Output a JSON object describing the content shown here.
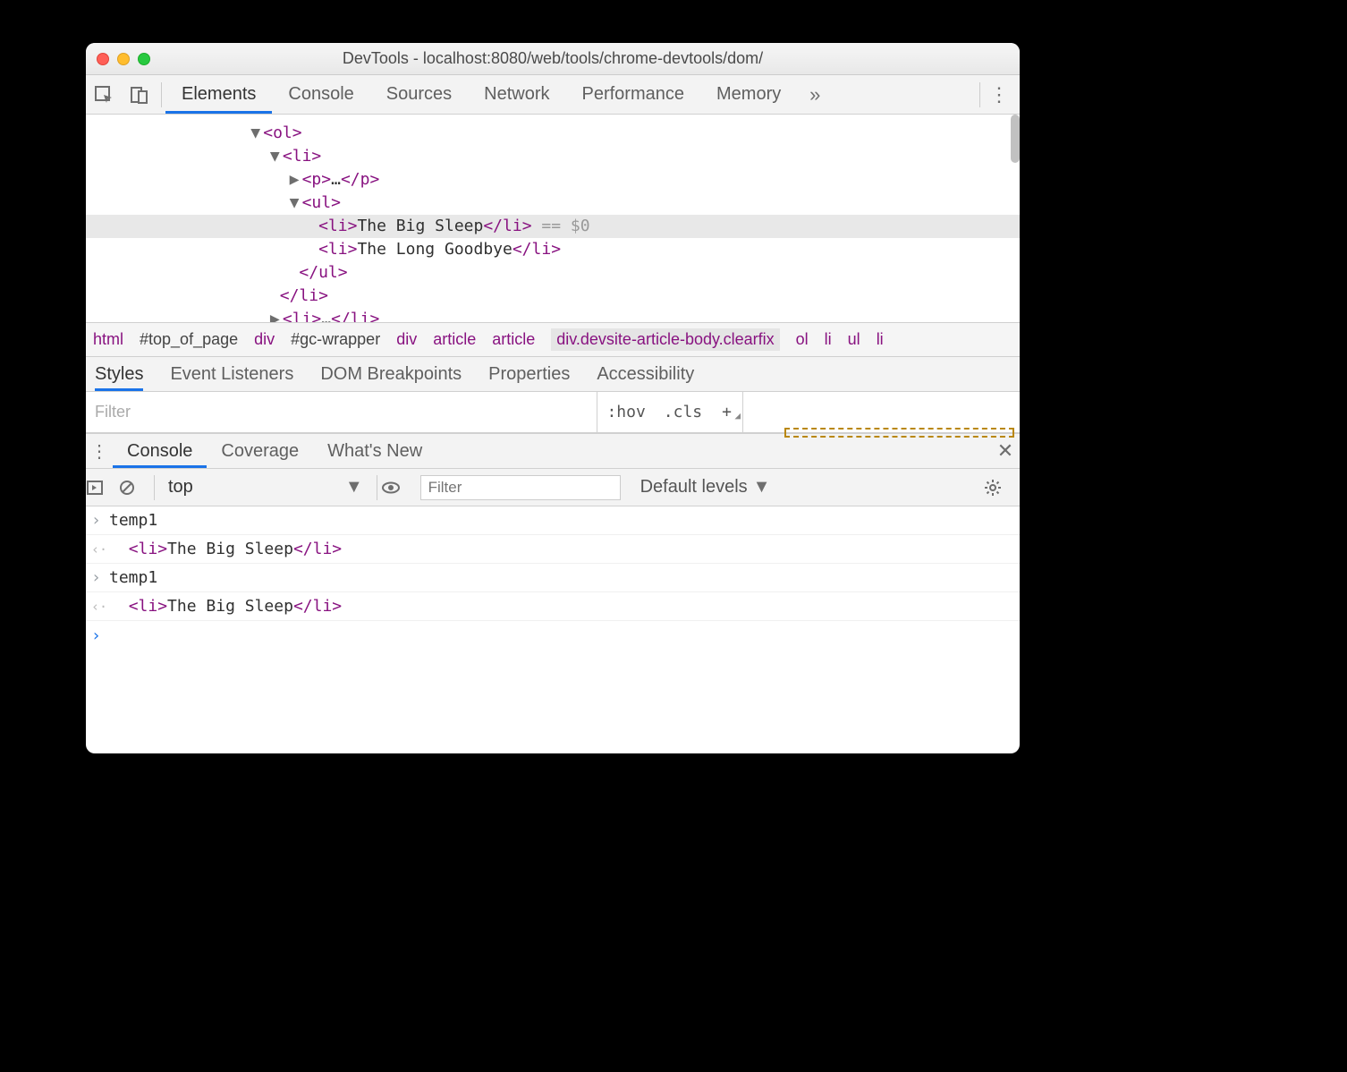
{
  "window": {
    "title": "DevTools - localhost:8080/web/tools/chrome-devtools/dom/"
  },
  "main_tabs": {
    "items": [
      "Elements",
      "Console",
      "Sources",
      "Network",
      "Performance",
      "Memory"
    ],
    "active_index": 0,
    "overflow_glyph": "»"
  },
  "dom": {
    "ol_open": "<ol>",
    "li_open": "<li>",
    "p_collapsed": "<p>…</p>",
    "ul_open": "<ul>",
    "li_text_1": "The Big Sleep",
    "li_text_2": "The Long Goodbye",
    "ul_close": "</ul>",
    "li_close": "</li>",
    "li_collapsed": "<li>…</li>",
    "refvar": "== $0"
  },
  "breadcrumb": {
    "items": [
      "html",
      "#top_of_page",
      "div",
      "#gc-wrapper",
      "div",
      "article",
      "article",
      "div.devsite-article-body.clearfix",
      "ol",
      "li",
      "ul",
      "li"
    ],
    "highlight_index": 7
  },
  "subtabs": {
    "items": [
      "Styles",
      "Event Listeners",
      "DOM Breakpoints",
      "Properties",
      "Accessibility"
    ],
    "active_index": 0
  },
  "styles_toolbar": {
    "filter_placeholder": "Filter",
    "hov": ":hov",
    "cls": ".cls"
  },
  "drawer_tabs": {
    "items": [
      "Console",
      "Coverage",
      "What's New"
    ],
    "active_index": 0
  },
  "console_toolbar": {
    "context": "top",
    "filter_placeholder": "Filter",
    "levels": "Default levels"
  },
  "console": {
    "rows": [
      {
        "kind": "in",
        "text": "temp1"
      },
      {
        "kind": "out",
        "html": "<li>The Big Sleep</li>"
      },
      {
        "kind": "in",
        "text": "temp1"
      },
      {
        "kind": "out",
        "html": "<li>The Big Sleep</li>"
      }
    ]
  }
}
